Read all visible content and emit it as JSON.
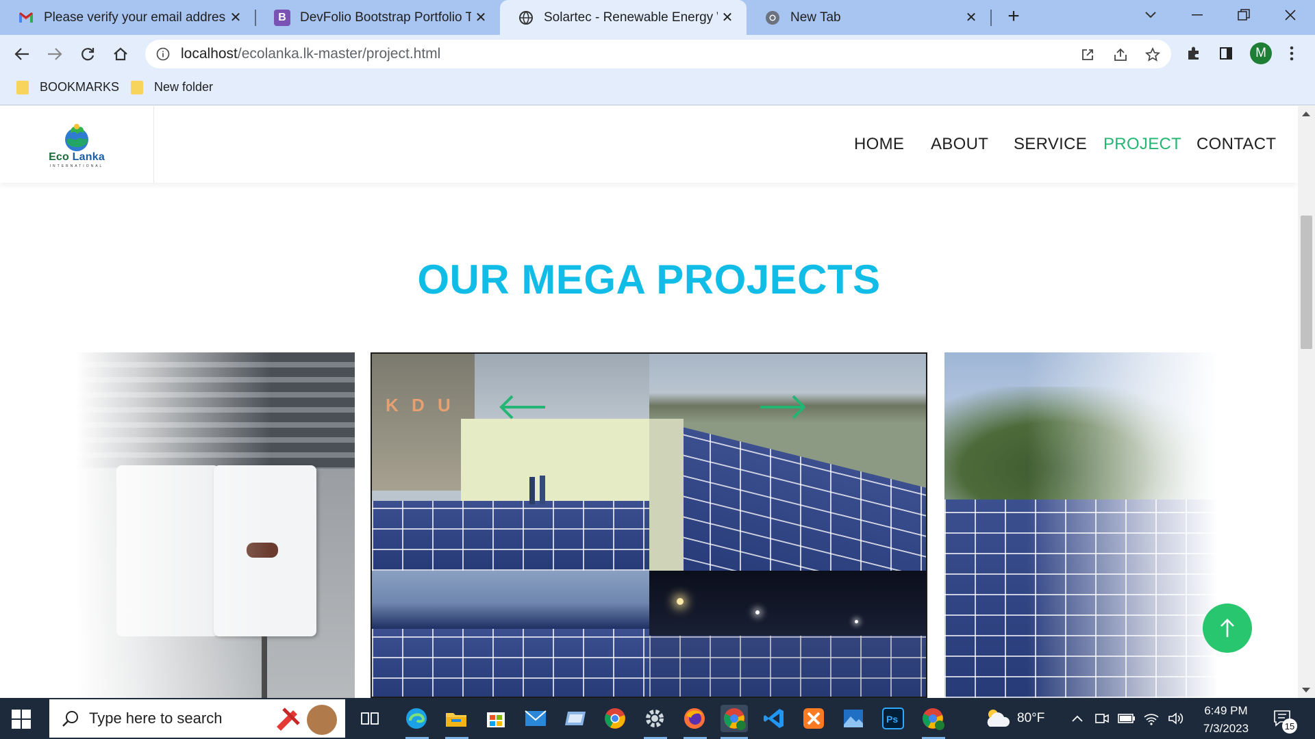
{
  "browser": {
    "tabs": [
      {
        "title": "Please verify your email address",
        "favicon": "gmail-icon",
        "active": false
      },
      {
        "title": "DevFolio Bootstrap Portfolio Tem",
        "favicon": "bootstrap-icon",
        "active": false
      },
      {
        "title": "Solartec - Renewable Energy Wel",
        "favicon": "globe-icon",
        "active": true
      },
      {
        "title": "New Tab",
        "favicon": "chrome-icon",
        "active": false
      }
    ],
    "new_tab_label": "+",
    "url_host": "localhost",
    "url_path": "/ecolanka.lk-master/project.html",
    "profile_initial": "M",
    "bookmarks": [
      {
        "label": "BOOKMARKS"
      },
      {
        "label": "New folder"
      }
    ]
  },
  "site": {
    "logo_word1": "Eco",
    "logo_word2": "Lanka",
    "logo_sub": "INTERNATIONAL",
    "nav": [
      {
        "label": "HOME",
        "active": false
      },
      {
        "label": "ABOUT",
        "active": false
      },
      {
        "label": "SERVICE",
        "active": false
      },
      {
        "label": "PROJECT",
        "active": true
      },
      {
        "label": "CONTACT",
        "active": false
      }
    ],
    "section_title": "OUR MEGA PROJECTS",
    "kdu_sign": "K D U",
    "accent_color": "#22b573",
    "title_color": "#11bde6"
  },
  "taskbar": {
    "search_placeholder": "Type here to search",
    "weather": "80°F",
    "time": "6:49 PM",
    "date": "7/3/2023",
    "notification_count": "15"
  }
}
